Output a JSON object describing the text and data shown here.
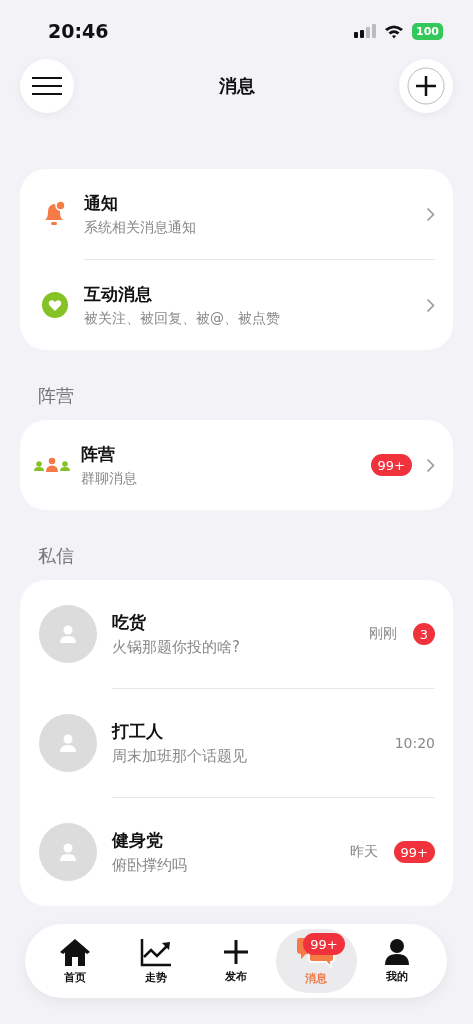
{
  "status_bar": {
    "time": "20:46",
    "battery": "100"
  },
  "header": {
    "title": "消息"
  },
  "notices": [
    {
      "kind": "bell",
      "title": "通知",
      "subtitle": "系统相关消息通知"
    },
    {
      "kind": "heart",
      "title": "互动消息",
      "subtitle": "被关注、被回复、被@、被点赞"
    }
  ],
  "camp_section": {
    "label": "阵营",
    "item": {
      "title": "阵营",
      "subtitle": "群聊消息",
      "badge": "99+"
    }
  },
  "dm_section": {
    "label": "私信",
    "chats": [
      {
        "name": "吃货",
        "preview": "火锅那题你投的啥?",
        "time": "刚刚",
        "badge": "3"
      },
      {
        "name": "打工人",
        "preview": "周末加班那个话题见",
        "time": "10:20"
      },
      {
        "name": "健身党",
        "preview": "俯卧撑约吗",
        "time": "昨天",
        "badge": "99+"
      }
    ]
  },
  "tab_bar": {
    "items": [
      {
        "kind": "home",
        "label": "首页",
        "selected": false
      },
      {
        "kind": "trend",
        "label": "走势",
        "selected": false
      },
      {
        "kind": "plus",
        "label": "发布",
        "selected": false
      },
      {
        "kind": "chat",
        "label": "消息",
        "selected": true,
        "badge": "99+"
      },
      {
        "kind": "user",
        "label": "我的",
        "selected": false
      }
    ]
  }
}
